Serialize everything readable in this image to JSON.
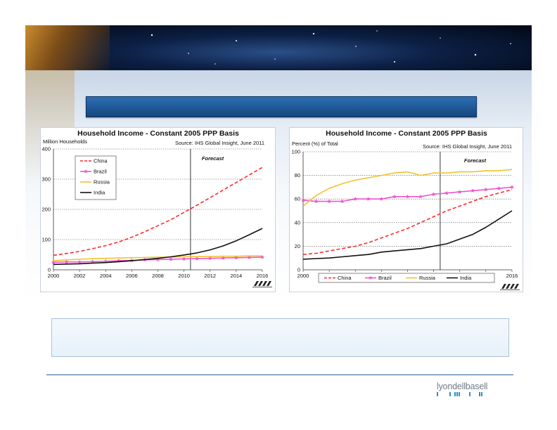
{
  "footer": {
    "logo": "lyondellbasell"
  },
  "chart_data": [
    {
      "type": "line",
      "title": "Household Income - Constant 2005 PPP Basis",
      "source": "Source: IHS Global Insight, June 2011",
      "ylabel": "Million Households",
      "xlabel": "",
      "annotation": "Forecast",
      "forecast_start": 2010.5,
      "ylim": [
        0,
        400
      ],
      "y_ticks": [
        "0",
        "100",
        "200",
        "300",
        "400"
      ],
      "xlim": [
        2000,
        2016
      ],
      "x_ticks": [
        "2000",
        "2002",
        "2004",
        "2006",
        "2008",
        "2010",
        "2012",
        "2014",
        "2016"
      ],
      "x": [
        2000,
        2001,
        2002,
        2003,
        2004,
        2005,
        2006,
        2007,
        2008,
        2009,
        2010,
        2011,
        2012,
        2013,
        2014,
        2015,
        2016
      ],
      "grid": "horizontal dotted",
      "legend_position": "top-left",
      "series": [
        {
          "name": "China",
          "color": "#ff2a2a",
          "style": "dashed",
          "marker": "none",
          "values": [
            48,
            54,
            61,
            70,
            80,
            92,
            108,
            126,
            146,
            166,
            190,
            214,
            239,
            264,
            289,
            314,
            339
          ]
        },
        {
          "name": "Brazil",
          "color": "#ee55cc",
          "style": "solid",
          "marker": "star",
          "values": [
            25,
            26,
            26,
            27,
            28,
            30,
            31,
            33,
            34,
            35,
            36,
            37,
            38,
            39,
            40,
            41,
            42
          ]
        },
        {
          "name": "Russia",
          "color": "#f2c230",
          "style": "solid",
          "marker": "none",
          "values": [
            30,
            33,
            35,
            37,
            38,
            39,
            40,
            41,
            42,
            42,
            43,
            44,
            44,
            45,
            45,
            46,
            46
          ]
        },
        {
          "name": "India",
          "color": "#111111",
          "style": "solid",
          "marker": "none",
          "values": [
            18,
            19,
            20,
            22,
            24,
            27,
            30,
            34,
            38,
            43,
            49,
            56,
            66,
            79,
            96,
            116,
            137
          ]
        }
      ]
    },
    {
      "type": "line",
      "title": "Household Income - Constant 2005 PPP Basis",
      "source": "Source: IHS Global Insight, June 2011",
      "ylabel": "Percent (%) of Total",
      "xlabel": "",
      "annotation": "Forecast",
      "forecast_start": 2010.5,
      "ylim": [
        0,
        100
      ],
      "y_ticks": [
        "0",
        "20",
        "40",
        "60",
        "80",
        "100"
      ],
      "xlim": [
        2000,
        2016
      ],
      "x_ticks": [
        "2000",
        "2002",
        "2004",
        "2006",
        "2008",
        "2010",
        "2012",
        "2014",
        "2016"
      ],
      "x": [
        2000,
        2001,
        2002,
        2003,
        2004,
        2005,
        2006,
        2007,
        2008,
        2009,
        2010,
        2011,
        2012,
        2013,
        2014,
        2015,
        2016
      ],
      "grid": "horizontal dotted",
      "legend_position": "bottom",
      "series": [
        {
          "name": "China",
          "color": "#ff2a2a",
          "style": "dashed",
          "marker": "none",
          "values": [
            13,
            14,
            16,
            18,
            20,
            23,
            27,
            31,
            35,
            40,
            45,
            50,
            54,
            58,
            62,
            65,
            68
          ]
        },
        {
          "name": "Brazil",
          "color": "#ee55cc",
          "style": "solid",
          "marker": "star",
          "values": [
            59,
            58,
            58,
            58,
            60,
            60,
            60,
            62,
            62,
            62,
            64,
            65,
            66,
            67,
            68,
            69,
            70
          ]
        },
        {
          "name": "Russia",
          "color": "#f2c230",
          "style": "solid",
          "marker": "none",
          "values": [
            54,
            63,
            69,
            73,
            76,
            78,
            80,
            82,
            83,
            80,
            82,
            82,
            83,
            83,
            84,
            84,
            85
          ]
        },
        {
          "name": "India",
          "color": "#111111",
          "style": "solid",
          "marker": "none",
          "values": [
            9,
            9.5,
            10,
            11,
            12,
            13,
            15,
            16,
            17,
            18,
            20,
            22,
            26,
            30,
            36,
            43,
            50
          ]
        }
      ]
    }
  ]
}
